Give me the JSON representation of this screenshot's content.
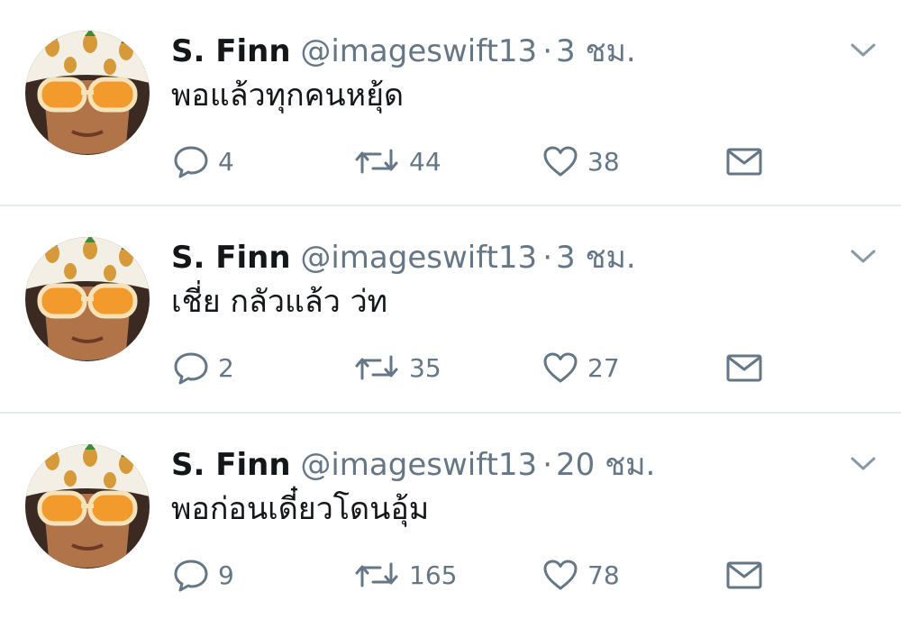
{
  "colors": {
    "primary_text": "#14171a",
    "secondary_text": "#657786",
    "divider": "#e6ecf0",
    "background": "#ffffff"
  },
  "icons": {
    "reply": "speech-bubble-icon",
    "retweet": "retweet-arrows-icon",
    "like": "heart-icon",
    "dm": "envelope-icon",
    "more": "chevron-down-icon"
  },
  "tweets": [
    {
      "name": "S. Finn",
      "handle": "@imageswift13",
      "separator": "·",
      "time": "3 ชม.",
      "text": "พอแล้วทุกคนหยุ้ด",
      "replies": "4",
      "retweets": "44",
      "likes": "38"
    },
    {
      "name": "S. Finn",
      "handle": "@imageswift13",
      "separator": "·",
      "time": "3 ชม.",
      "text": "เชี่ย กลัวแล้ว ว่ท",
      "replies": "2",
      "retweets": "35",
      "likes": "27"
    },
    {
      "name": "S. Finn",
      "handle": "@imageswift13",
      "separator": "·",
      "time": "20 ชม.",
      "text": "พอก่อนเดี๋ยวโดนอุ้ม",
      "replies": "9",
      "retweets": "165",
      "likes": "78"
    }
  ]
}
